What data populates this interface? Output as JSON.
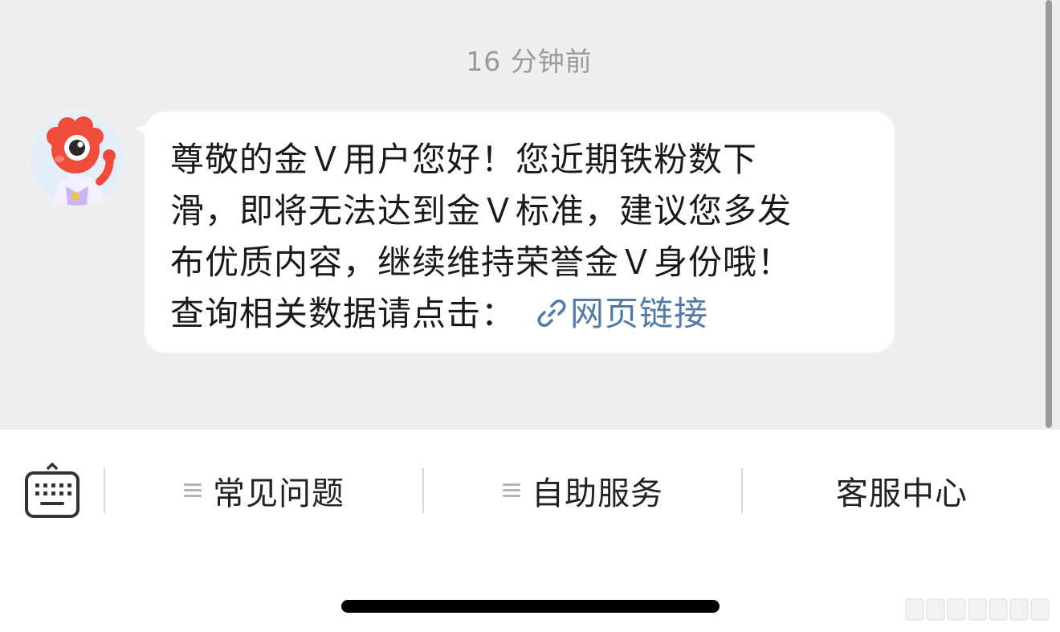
{
  "chat": {
    "timestamp": "16 分钟前",
    "message": {
      "lines": [
        "尊敬的金Ｖ用户您好！您近期铁粉数下",
        "滑，即将无法达到金Ｖ标准，建议您多发",
        "布优质内容，继续维持荣誉金Ｖ身份哦！"
      ],
      "prompt": "查询相关数据请点击：",
      "link_label": "网页链接"
    },
    "avatar_icon": "red-mascot-avatar-icon",
    "link_icon": "link-chain-icon",
    "colors": {
      "background": "#efeff0",
      "bubble": "#ffffff",
      "link": "#517aa8"
    }
  },
  "bottom_bar": {
    "keyboard_icon": "keyboard-icon",
    "items": [
      {
        "label": "常见问题",
        "icon": "menu-lines-icon"
      },
      {
        "label": "自助服务",
        "icon": "menu-lines-icon"
      },
      {
        "label": "客服中心",
        "icon": ""
      }
    ]
  }
}
